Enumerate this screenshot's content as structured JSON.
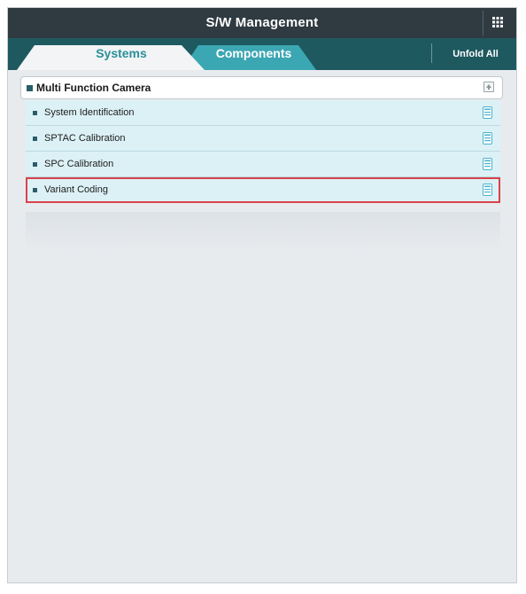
{
  "header": {
    "title": "S/W Management",
    "menu_icon": "grid-icon"
  },
  "tabs": [
    {
      "label": "Systems",
      "active": true
    },
    {
      "label": "Components",
      "active": false
    }
  ],
  "unfold_all_label": "Unfold All",
  "group": {
    "title": "Multi Function Camera",
    "toggle_icon": "collapse-up-icon",
    "items": [
      {
        "label": "System Identification",
        "icon": "document-icon",
        "highlighted": false
      },
      {
        "label": "SPTAC Calibration",
        "icon": "document-icon",
        "highlighted": false
      },
      {
        "label": "SPC Calibration",
        "icon": "document-icon",
        "highlighted": false
      },
      {
        "label": "Variant Coding",
        "icon": "document-icon",
        "highlighted": true
      }
    ]
  },
  "colors": {
    "title_bar": "#2f3a41",
    "tab_bar": "#1f5960",
    "active_tab_text": "#2a8f99",
    "inactive_tab": "#3ba7b2",
    "item_background": "#dcf1f6",
    "highlight_border": "#d9434a",
    "document_icon": "#4bb2cc"
  }
}
